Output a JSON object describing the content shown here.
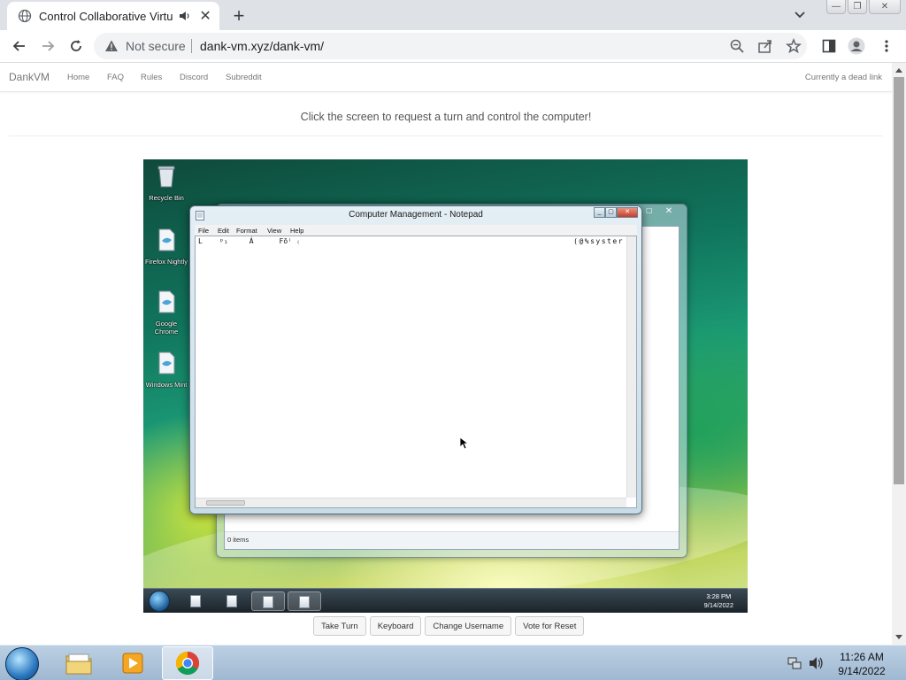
{
  "browser": {
    "tab_title": "Control Collaborative Virtual",
    "new_tab_symbol": "+",
    "tab_close_symbol": "✕",
    "security_label": "Not secure",
    "url": "dank-vm.xyz/dank-vm/",
    "window_controls": {
      "minimize": "—",
      "restore": "❐",
      "close": "✕"
    }
  },
  "site": {
    "brand": "DankVM",
    "nav": [
      "Home",
      "FAQ",
      "Rules",
      "Discord",
      "Subreddit"
    ],
    "dead_link_text": "Currently a dead link",
    "instruction": "Click the screen to request a turn and control the computer!"
  },
  "vm": {
    "desktop_icons": [
      {
        "label": "Recycle Bin"
      },
      {
        "label": "Firefox Nightly"
      },
      {
        "label": "Google Chrome"
      },
      {
        "label": "Windows Mint"
      }
    ],
    "notepad": {
      "title": "Computer Management - Notepad",
      "menus": [
        "File",
        "Edit",
        "Format",
        "View",
        "Help"
      ],
      "text_left": "L    ᵖ₁     Á      Fõ⁽ ₍",
      "text_right": "(@%syster",
      "scroll_thumb_glyph": "|||"
    },
    "explorer": {
      "status_items": "0 items"
    },
    "clock_time": "3:28 PM",
    "clock_date": "9/14/2022"
  },
  "controls": {
    "take_turn": "Take Turn",
    "keyboard": "Keyboard",
    "change_username": "Change Username",
    "vote_reset": "Vote for Reset"
  },
  "host": {
    "clock_time": "11:26 AM",
    "clock_date": "9/14/2022"
  },
  "colors": {
    "accent_chrome": "#1a73e8",
    "site_text": "#777777",
    "taskbar_start": "#bcd0e4"
  }
}
